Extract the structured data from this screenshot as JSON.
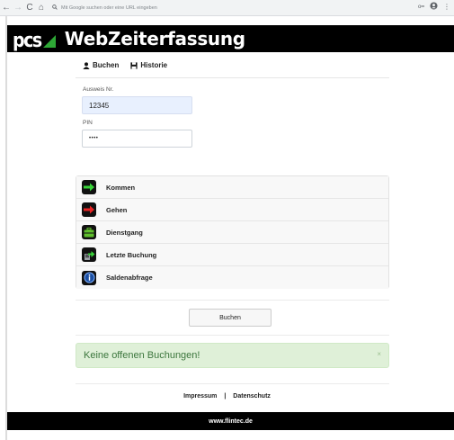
{
  "browser": {
    "omnibox_placeholder": "Mit Google suchen oder eine URL eingeben"
  },
  "app": {
    "logo_text": "pcs",
    "title": "WebZeiterfassung"
  },
  "tabs": [
    {
      "label": "Buchen",
      "icon": "user-icon"
    },
    {
      "label": "Historie",
      "icon": "save-icon"
    }
  ],
  "form": {
    "badge_label": "Ausweis Nr.",
    "badge_value": "12345",
    "pin_label": "PIN",
    "pin_value": "••••"
  },
  "actions": [
    {
      "label": "Kommen",
      "icon": "arrow-right-green-icon",
      "color": "#39d339"
    },
    {
      "label": "Gehen",
      "icon": "arrow-right-red-icon",
      "color": "#e82424"
    },
    {
      "label": "Dienstgang",
      "icon": "briefcase-icon",
      "color": "#5fbf2d"
    },
    {
      "label": "Letzte Buchung",
      "icon": "last-booking-icon",
      "color": "#39d339"
    },
    {
      "label": "Saldenabfrage",
      "icon": "info-icon",
      "color": "#3a7bd5"
    }
  ],
  "submit_label": "Buchen",
  "alert": {
    "message": "Keine offenen Buchungen!",
    "close": "×"
  },
  "footer": {
    "impressum": "Impressum",
    "separator": "|",
    "datenschutz": "Datenschutz",
    "site": "www.flintec.de"
  },
  "colors": {
    "header_bg": "#000000",
    "logo_green": "#2ea836",
    "alert_bg": "#dff0d8",
    "alert_text": "#3c763d"
  }
}
